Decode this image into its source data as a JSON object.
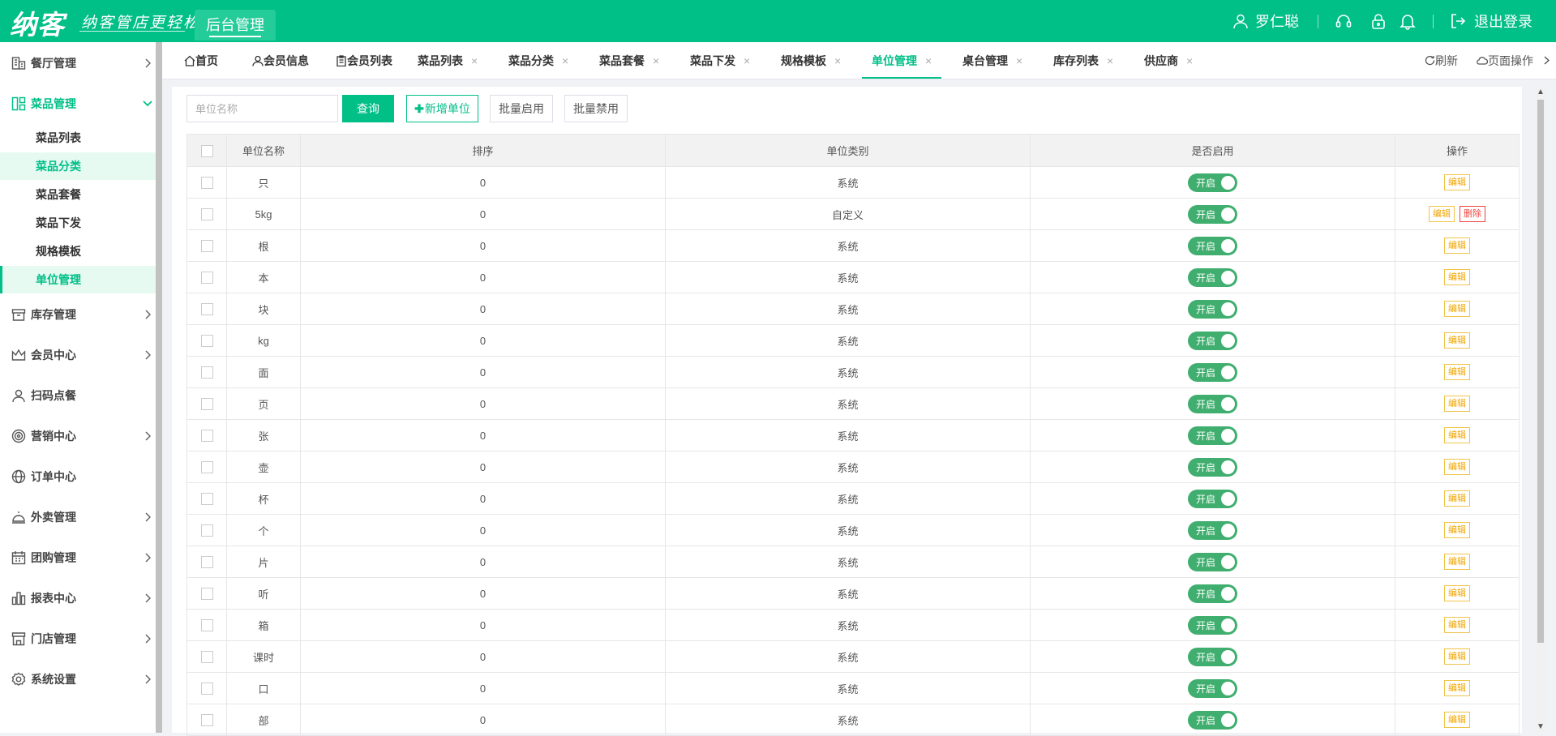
{
  "header": {
    "logo": "纳客",
    "slogan": "纳客管店更轻松",
    "admin_tab": "后台管理",
    "user_name": "罗仁聪",
    "logout": "退出登录"
  },
  "sidebar": {
    "items": [
      {
        "label": "餐厅管理"
      },
      {
        "label": "菜品管理"
      },
      {
        "label": "库存管理"
      },
      {
        "label": "会员中心"
      },
      {
        "label": "扫码点餐"
      },
      {
        "label": "营销中心"
      },
      {
        "label": "订单中心"
      },
      {
        "label": "外卖管理"
      },
      {
        "label": "团购管理"
      },
      {
        "label": "报表中心"
      },
      {
        "label": "门店管理"
      },
      {
        "label": "系统设置"
      }
    ],
    "subitems": [
      {
        "label": "菜品列表"
      },
      {
        "label": "菜品分类"
      },
      {
        "label": "菜品套餐"
      },
      {
        "label": "菜品下发"
      },
      {
        "label": "规格模板"
      },
      {
        "label": "单位管理"
      }
    ]
  },
  "tabs": {
    "items": [
      {
        "label": "首页"
      },
      {
        "label": "会员信息"
      },
      {
        "label": "会员列表"
      },
      {
        "label": "菜品列表",
        "close": "×"
      },
      {
        "label": "菜品分类",
        "close": "×"
      },
      {
        "label": "菜品套餐",
        "close": "×"
      },
      {
        "label": "菜品下发",
        "close": "×"
      },
      {
        "label": "规格模板",
        "close": "×"
      },
      {
        "label": "单位管理",
        "close": "×"
      },
      {
        "label": "桌台管理",
        "close": "×"
      },
      {
        "label": "库存列表",
        "close": "×"
      },
      {
        "label": "供应商",
        "close": "×"
      }
    ],
    "refresh": "刷新",
    "page_ops": "页面操作"
  },
  "toolbar": {
    "search_placeholder": "单位名称",
    "search_value": "",
    "query": "查询",
    "add": "新增单位",
    "batch_enable": "批量启用",
    "batch_disable": "批量禁用"
  },
  "table": {
    "headers": {
      "name": "单位名称",
      "sort": "排序",
      "type": "单位类别",
      "enabled": "是否启用",
      "ops": "操作"
    },
    "switch_on_label": "开启",
    "edit_label": "编辑",
    "delete_label": "删除",
    "rows": [
      {
        "name": "只",
        "sort": "0",
        "type": "系统",
        "deletable": false
      },
      {
        "name": "5kg",
        "sort": "0",
        "type": "自定义",
        "deletable": true
      },
      {
        "name": "根",
        "sort": "0",
        "type": "系统",
        "deletable": false
      },
      {
        "name": "本",
        "sort": "0",
        "type": "系统",
        "deletable": false
      },
      {
        "name": "块",
        "sort": "0",
        "type": "系统",
        "deletable": false
      },
      {
        "name": "kg",
        "sort": "0",
        "type": "系统",
        "deletable": false
      },
      {
        "name": "面",
        "sort": "0",
        "type": "系统",
        "deletable": false
      },
      {
        "name": "页",
        "sort": "0",
        "type": "系统",
        "deletable": false
      },
      {
        "name": "张",
        "sort": "0",
        "type": "系统",
        "deletable": false
      },
      {
        "name": "壶",
        "sort": "0",
        "type": "系统",
        "deletable": false
      },
      {
        "name": "杯",
        "sort": "0",
        "type": "系统",
        "deletable": false
      },
      {
        "name": "个",
        "sort": "0",
        "type": "系统",
        "deletable": false
      },
      {
        "name": "片",
        "sort": "0",
        "type": "系统",
        "deletable": false
      },
      {
        "name": "听",
        "sort": "0",
        "type": "系统",
        "deletable": false
      },
      {
        "name": "箱",
        "sort": "0",
        "type": "系统",
        "deletable": false
      },
      {
        "name": "课时",
        "sort": "0",
        "type": "系统",
        "deletable": false
      },
      {
        "name": "口",
        "sort": "0",
        "type": "系统",
        "deletable": false
      },
      {
        "name": "部",
        "sort": "0",
        "type": "系统",
        "deletable": false
      }
    ]
  },
  "colors": {
    "brand": "#00bf87",
    "switch_on": "#3fae6e",
    "edit": "#f0a500",
    "delete": "#f0443c"
  }
}
